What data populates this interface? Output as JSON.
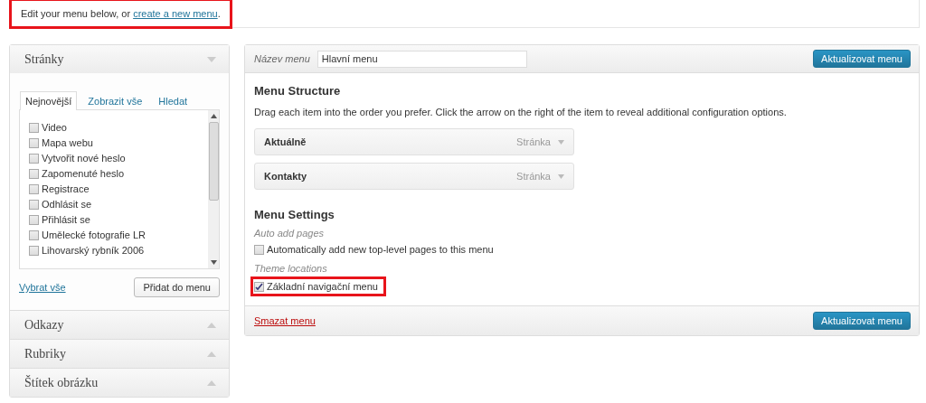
{
  "notice": {
    "text": "Edit your menu below, or ",
    "link": "create a new menu",
    "after": ".",
    "highlighted": true
  },
  "sidebar": {
    "sections": [
      {
        "title": "Stránky",
        "expanded": true,
        "tabs": [
          {
            "label": "Nejnovější",
            "selected": true
          },
          {
            "label": "Zobrazit vše",
            "selected": false
          },
          {
            "label": "Hledat",
            "selected": false
          }
        ],
        "items": [
          {
            "label": "Video",
            "checked": false
          },
          {
            "label": "Mapa webu",
            "checked": false
          },
          {
            "label": "Vytvořit nové heslo",
            "checked": false
          },
          {
            "label": "Zapomenuté heslo",
            "checked": false
          },
          {
            "label": "Registrace",
            "checked": false
          },
          {
            "label": "Odhlásit se",
            "checked": false
          },
          {
            "label": "Přihlásit se",
            "checked": false
          },
          {
            "label": "Umělecké fotografie LR",
            "checked": false
          },
          {
            "label": "Lihovarský rybník 2006",
            "checked": false
          }
        ],
        "select_all": "Vybrat vše",
        "add_button": "Přidat do menu"
      },
      {
        "title": "Odkazy",
        "expanded": false
      },
      {
        "title": "Rubriky",
        "expanded": false
      },
      {
        "title": "Štítek obrázku",
        "expanded": false
      }
    ]
  },
  "editor": {
    "name_label": "Název menu",
    "name_value": "Hlavní menu",
    "save_button": "Aktualizovat menu",
    "structure_title": "Menu Structure",
    "structure_help": "Drag each item into the order you prefer. Click the arrow on the right of the item to reveal additional configuration options.",
    "menu_items": [
      {
        "title": "Aktuálně",
        "type": "Stránka"
      },
      {
        "title": "Kontakty",
        "type": "Stránka"
      }
    ],
    "settings_title": "Menu Settings",
    "settings": [
      {
        "heading": "Auto add pages",
        "label": "Automatically add new top-level pages to this menu",
        "checked": false,
        "highlighted": false
      },
      {
        "heading": "Theme locations",
        "label": "Základní navigační menu",
        "checked": true,
        "highlighted": true
      }
    ],
    "delete_link": "Smazat menu",
    "footer_button": "Aktualizovat menu"
  }
}
